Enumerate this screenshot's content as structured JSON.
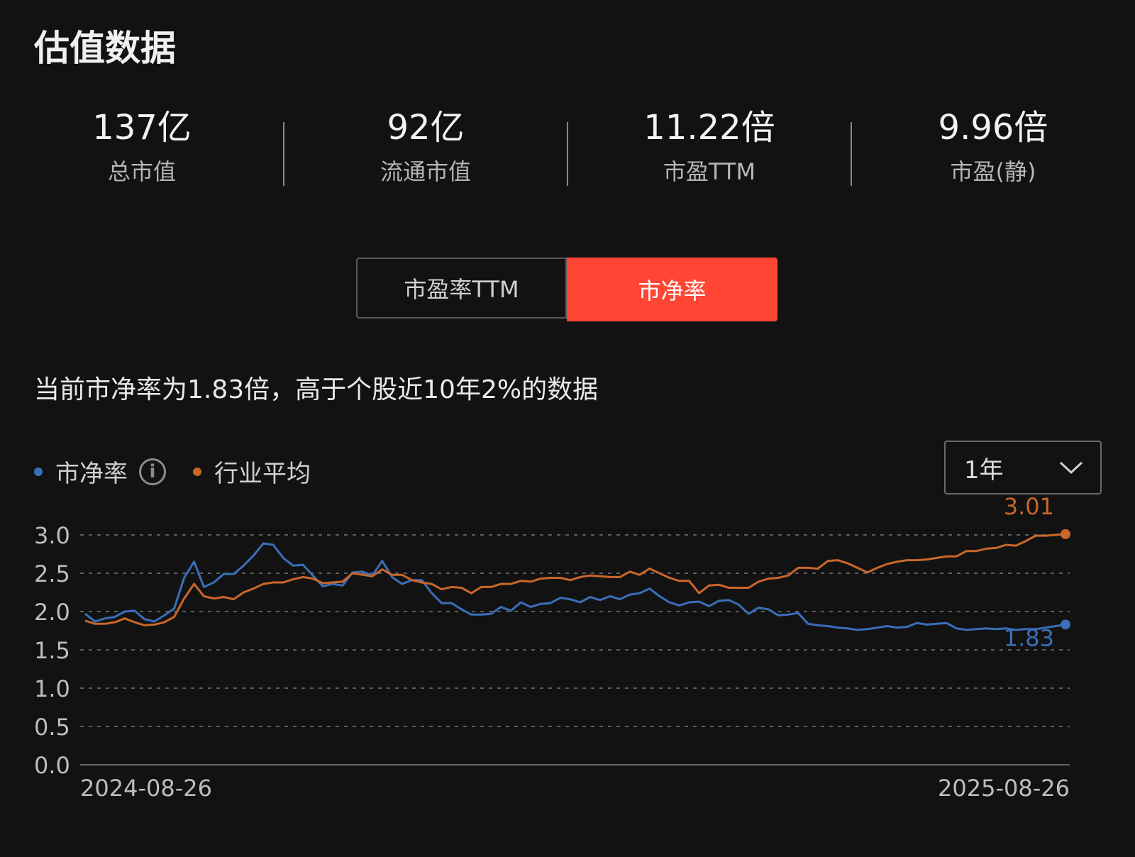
{
  "title": "估值数据",
  "metrics": [
    {
      "value": "137亿",
      "label": "总市值"
    },
    {
      "value": "92亿",
      "label": "流通市值"
    },
    {
      "value": "11.22倍",
      "label": "市盈TTM"
    },
    {
      "value": "9.96倍",
      "label": "市盈(静)"
    }
  ],
  "tabs": {
    "pe_ttm": "市盈率TTM",
    "pb": "市净率"
  },
  "description": "当前市净率为1.83倍，高于个股近10年2%的数据",
  "legend": {
    "series_a": "市净率",
    "series_b": "行业平均",
    "info_icon": "info-icon"
  },
  "period": {
    "selected": "1年",
    "icon": "chevron-down-icon"
  },
  "colors": {
    "background": "#121212",
    "accent": "#ff4533",
    "series_pb": "#3a6fb9",
    "series_industry": "#c9672b",
    "grid": "#5e5e5e"
  },
  "chart_data": {
    "type": "line",
    "x_start_label": "2024-08-26",
    "x_end_label": "2025-08-26",
    "ylim": [
      0,
      3.0
    ],
    "yticks": [
      "0.0",
      "0.5",
      "1.0",
      "1.5",
      "2.0",
      "2.5",
      "3.0"
    ],
    "grid": true,
    "series": [
      {
        "name": "市净率",
        "color": "#3a6fb9",
        "last_label": "1.83",
        "values": [
          1.97,
          1.87,
          1.91,
          1.93,
          2.0,
          2.01,
          1.9,
          1.87,
          1.95,
          2.04,
          2.44,
          2.65,
          2.32,
          2.38,
          2.49,
          2.49,
          2.6,
          2.73,
          2.89,
          2.87,
          2.7,
          2.6,
          2.61,
          2.47,
          2.33,
          2.36,
          2.34,
          2.51,
          2.52,
          2.47,
          2.66,
          2.45,
          2.36,
          2.41,
          2.41,
          2.24,
          2.11,
          2.11,
          2.03,
          1.96,
          1.96,
          1.97,
          2.06,
          2.01,
          2.12,
          2.06,
          2.1,
          2.11,
          2.18,
          2.16,
          2.12,
          2.19,
          2.15,
          2.2,
          2.16,
          2.22,
          2.24,
          2.3,
          2.2,
          2.12,
          2.08,
          2.12,
          2.13,
          2.07,
          2.14,
          2.15,
          2.09,
          1.97,
          2.05,
          2.03,
          1.95,
          1.96,
          1.98,
          1.84,
          1.82,
          1.81,
          1.79,
          1.78,
          1.76,
          1.77,
          1.79,
          1.81,
          1.79,
          1.8,
          1.85,
          1.83,
          1.84,
          1.85,
          1.78,
          1.76,
          1.77,
          1.78,
          1.77,
          1.78,
          1.76,
          1.77,
          1.77,
          1.79,
          1.81,
          1.83
        ]
      },
      {
        "name": "行业平均",
        "color": "#c9672b",
        "last_label": "3.01",
        "values": [
          1.88,
          1.84,
          1.84,
          1.86,
          1.91,
          1.86,
          1.82,
          1.83,
          1.86,
          1.93,
          2.17,
          2.36,
          2.2,
          2.17,
          2.19,
          2.16,
          2.25,
          2.3,
          2.36,
          2.38,
          2.38,
          2.42,
          2.45,
          2.43,
          2.37,
          2.38,
          2.39,
          2.5,
          2.48,
          2.46,
          2.55,
          2.48,
          2.48,
          2.41,
          2.38,
          2.36,
          2.29,
          2.32,
          2.31,
          2.24,
          2.32,
          2.32,
          2.36,
          2.36,
          2.4,
          2.39,
          2.43,
          2.44,
          2.44,
          2.41,
          2.45,
          2.47,
          2.46,
          2.45,
          2.45,
          2.52,
          2.48,
          2.56,
          2.5,
          2.44,
          2.4,
          2.4,
          2.24,
          2.34,
          2.35,
          2.31,
          2.31,
          2.31,
          2.39,
          2.43,
          2.44,
          2.47,
          2.57,
          2.57,
          2.56,
          2.66,
          2.67,
          2.63,
          2.57,
          2.51,
          2.57,
          2.62,
          2.65,
          2.67,
          2.67,
          2.68,
          2.7,
          2.72,
          2.72,
          2.79,
          2.79,
          2.82,
          2.83,
          2.87,
          2.86,
          2.92,
          2.99,
          2.99,
          3.0,
          3.01
        ]
      }
    ]
  }
}
